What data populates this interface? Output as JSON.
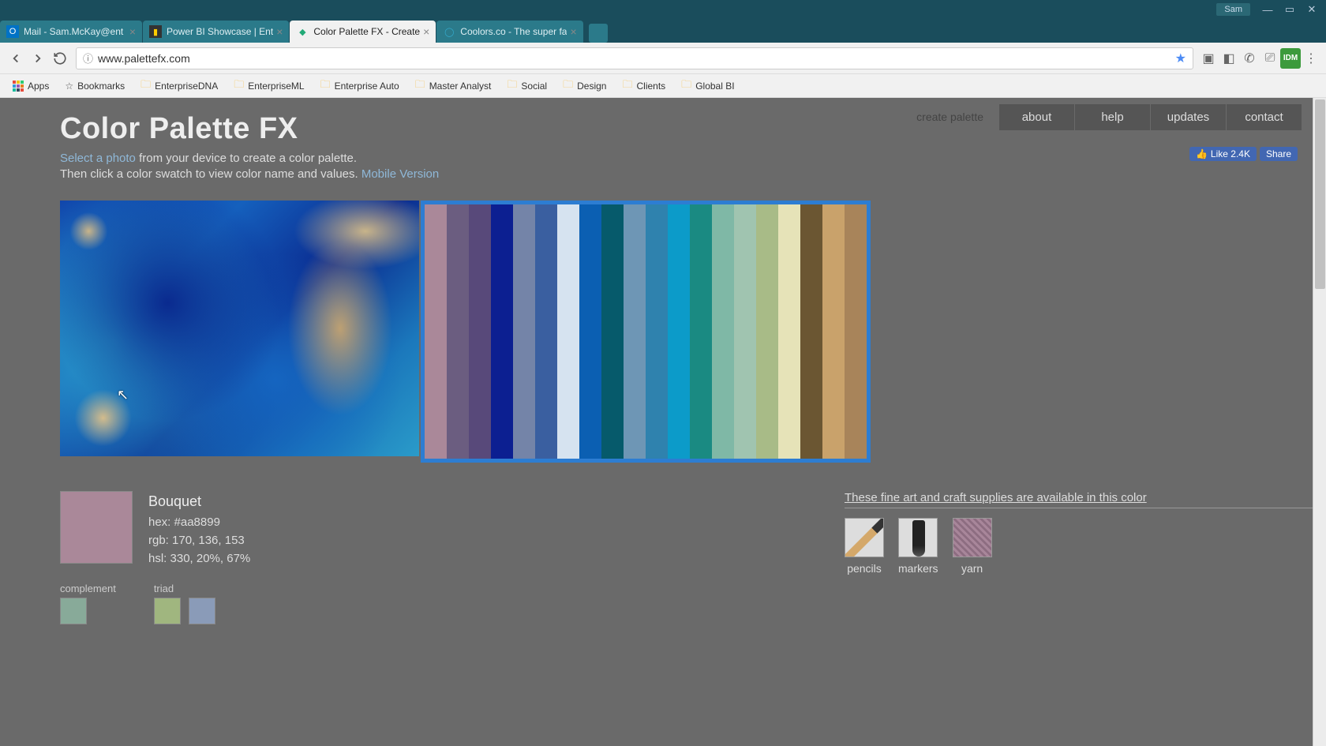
{
  "window": {
    "user": "Sam"
  },
  "tabs": [
    {
      "title": "Mail - Sam.McKay@ent",
      "active": false
    },
    {
      "title": "Power BI Showcase | Ent",
      "active": false
    },
    {
      "title": "Color Palette FX - Create",
      "active": true
    },
    {
      "title": "Coolors.co - The super fa",
      "active": false
    }
  ],
  "address": {
    "url": "www.palettefx.com"
  },
  "bookmarks": {
    "apps": "Apps",
    "bookmark_label": "Bookmarks",
    "items": [
      "EnterpriseDNA",
      "EnterpriseML",
      "Enterprise Auto",
      "Master Analyst",
      "Social",
      "Design",
      "Clients",
      "Global BI"
    ]
  },
  "nav": {
    "ghost": "create palette",
    "items": [
      "about",
      "help",
      "updates",
      "contact"
    ]
  },
  "social": {
    "like": "Like 2.4K",
    "share": "Share"
  },
  "header": {
    "title": "Color Palette FX",
    "select_photo": "Select a photo",
    "desc1_rest": " from your device to create a color palette.",
    "desc2": "Then click a color swatch to view color name and values. ",
    "mobile": "Mobile Version"
  },
  "palette": {
    "swatches": [
      "#aa8899",
      "#6b5d80",
      "#58497a",
      "#0c1f91",
      "#7484a8",
      "#3a5fa0",
      "#d6e3f0",
      "#0b5fb2",
      "#065a6b",
      "#6e96b5",
      "#2f82ae",
      "#0c9bc9",
      "#1a8a82",
      "#7fb8a6",
      "#a0c4b0",
      "#a8bb87",
      "#e6e3b8",
      "#6b5632",
      "#c9a26b",
      "#a8845a"
    ]
  },
  "selected": {
    "color": "#aa8899",
    "name": "Bouquet",
    "hex_label": "hex: #aa8899",
    "rgb_label": "rgb: 170, 136, 153",
    "hsl_label": "hsl: 330, 20%, 67%"
  },
  "harmony": {
    "complement": {
      "label": "complement",
      "colors": [
        "#88aa99"
      ]
    },
    "triad": {
      "label": "triad",
      "colors": [
        "#a0b67f",
        "#8a9bb8"
      ]
    }
  },
  "supplies": {
    "heading": "These fine art and craft supplies are available in this color",
    "items": [
      "pencils",
      "markers",
      "yarn"
    ]
  }
}
